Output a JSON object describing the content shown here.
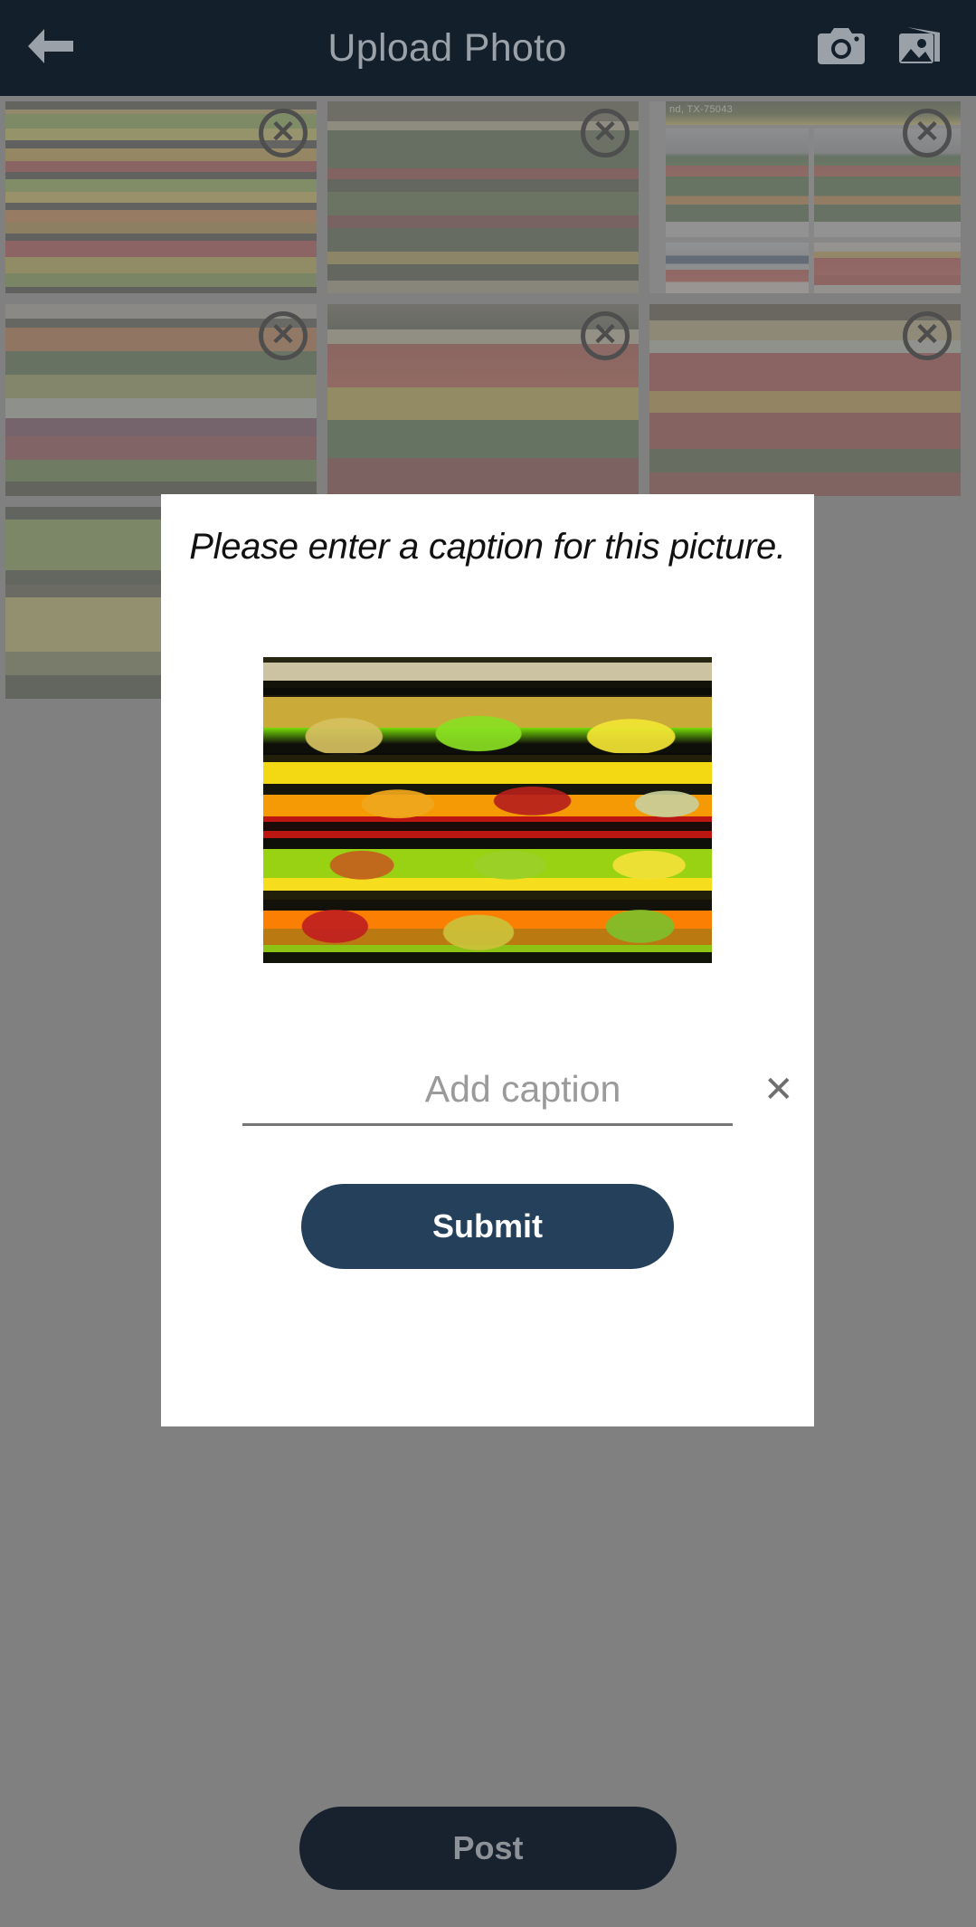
{
  "header": {
    "back_icon": "arrow-left-icon",
    "title": "Upload Photo",
    "camera_icon": "camera-icon",
    "gallery_icon": "gallery-icon"
  },
  "gallery": {
    "delete_badge_label": "✕",
    "rows": [
      [
        {
          "id": "thumb-1",
          "alt": "Grocery produce shelves with fruit",
          "style": "shelf-a",
          "has_delete": true
        },
        {
          "id": "thumb-2",
          "alt": "Supermarket vegetable aisle shelves",
          "style": "shelf-b",
          "has_delete": true
        },
        {
          "id": "thumb-3",
          "alt": "Store aisle collage",
          "style": "composite",
          "has_delete": true,
          "overlay_text": "nd, TX-75043"
        }
      ],
      [
        {
          "id": "thumb-4",
          "alt": "Produce display with peppers and cabbage",
          "style": "shelf-d",
          "has_delete": true
        },
        {
          "id": "thumb-5",
          "alt": "Tomatoes and peppers display",
          "style": "shelf-e",
          "has_delete": true
        },
        {
          "id": "thumb-6",
          "alt": "Blurred grocery shelf with fruit",
          "style": "shelf-f",
          "has_delete": true
        }
      ],
      [
        {
          "id": "thumb-7",
          "alt": "Green apples and pineapples in crates",
          "style": "shelf-g",
          "has_delete": false
        }
      ]
    ]
  },
  "post_button": {
    "label": "Post"
  },
  "dialog": {
    "title": "Please enter a caption for this picture.",
    "preview_alt": "Supermarket produce display with apples, lemons, pineapples and melons",
    "caption_input": {
      "value": "",
      "placeholder": "Add caption"
    },
    "clear_icon": "close-icon",
    "clear_label": "✕",
    "submit_label": "Submit"
  },
  "colors": {
    "appbar_bg": "#131f2b",
    "appbar_text": "#9aa1a8",
    "scrim": "#808080",
    "submit_bg": "#25405a",
    "submit_text": "#ffffff",
    "post_bg": "#18222e",
    "post_text": "#8c9298",
    "dialog_bg": "#ffffff"
  }
}
